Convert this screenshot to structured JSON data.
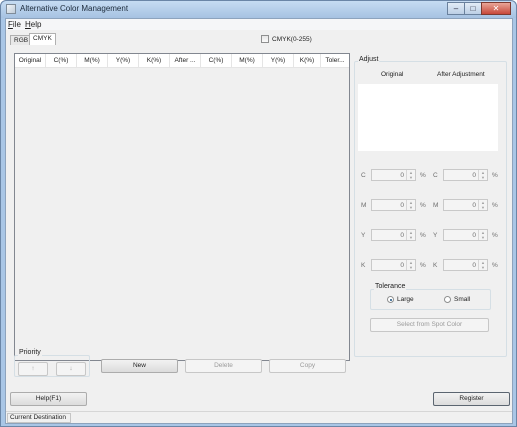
{
  "window": {
    "title": "Alternative Color Management",
    "minimize_glyph": "–",
    "maximize_glyph": "□",
    "close_glyph": "✕"
  },
  "menu": [
    {
      "label": "File",
      "accel": "F",
      "rest": "ile"
    },
    {
      "label": "Help",
      "accel": "H",
      "rest": "elp"
    }
  ],
  "tabs": [
    {
      "label": "RGB",
      "active": false
    },
    {
      "label": "CMYK",
      "active": true
    }
  ],
  "cmyk_range_checkbox": {
    "label": "CMYK(0-255)",
    "checked": false
  },
  "list": {
    "columns": [
      "Original",
      "C(%)",
      "M(%)",
      "Y(%)",
      "K(%)",
      "After ...",
      "C(%)",
      "M(%)",
      "Y(%)",
      "K(%)",
      "Toler..."
    ]
  },
  "adjust": {
    "title": "Adjust",
    "original_label": "Original",
    "after_label": "After Adjustment",
    "rows": [
      {
        "channel": "C",
        "original": "0",
        "after": "0"
      },
      {
        "channel": "M",
        "original": "0",
        "after": "0"
      },
      {
        "channel": "Y",
        "original": "0",
        "after": "0"
      },
      {
        "channel": "K",
        "original": "0",
        "after": "0"
      }
    ],
    "unit": "%",
    "tolerance": {
      "title": "Tolerance",
      "options": [
        {
          "label": "Large",
          "selected": true
        },
        {
          "label": "Small",
          "selected": false
        }
      ]
    },
    "spot_button": "Select from Spot Color"
  },
  "priority": {
    "title": "Priority",
    "up_glyph": "↑",
    "down_glyph": "↓"
  },
  "buttons": {
    "new": "New",
    "delete": "Delete",
    "copy": "Copy",
    "help": "Help(F1)",
    "register": "Register"
  },
  "status": {
    "current_destination": "Current Destination"
  },
  "colors": {
    "title_bar": "#a9c6e6",
    "client_bg": "#f0f0f0",
    "close_button": "#c7483a"
  }
}
